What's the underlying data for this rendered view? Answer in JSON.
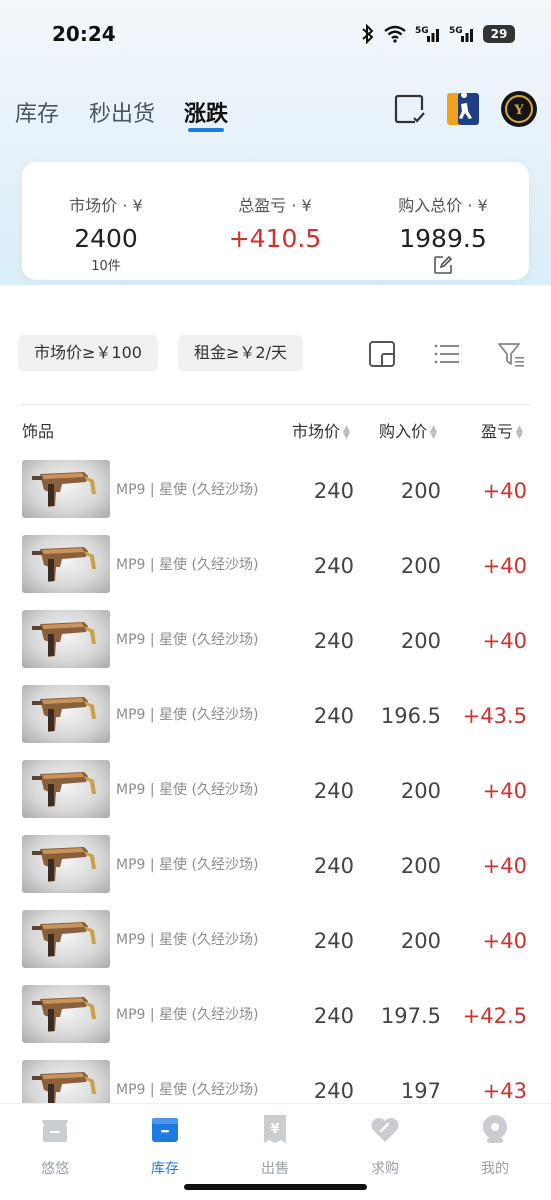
{
  "status": {
    "time": "20:24",
    "battery": "29",
    "net1": "5G",
    "net2": "5G"
  },
  "nav": {
    "tabs": [
      "库存",
      "秒出货",
      "涨跌"
    ],
    "active": 2
  },
  "summary": {
    "market": {
      "label": "市场价 · ¥",
      "value": "2400",
      "sub": "10件"
    },
    "profit": {
      "label": "总盈亏 · ¥",
      "value": "+410.5"
    },
    "cost": {
      "label": "购入总价 · ¥",
      "value": "1989.5"
    }
  },
  "filters": {
    "price_chip": "市场价≥￥100",
    "rent_chip": "租金≥￥2/天"
  },
  "table": {
    "headers": {
      "item": "饰品",
      "market": "市场价",
      "buy": "购入价",
      "pnl": "盈亏"
    },
    "rows": [
      {
        "name": "MP9 | 星使 (久经沙场)",
        "market": "240",
        "buy": "200",
        "pnl": "+40"
      },
      {
        "name": "MP9 | 星使 (久经沙场)",
        "market": "240",
        "buy": "200",
        "pnl": "+40"
      },
      {
        "name": "MP9 | 星使 (久经沙场)",
        "market": "240",
        "buy": "200",
        "pnl": "+40"
      },
      {
        "name": "MP9 | 星使 (久经沙场)",
        "market": "240",
        "buy": "196.5",
        "pnl": "+43.5"
      },
      {
        "name": "MP9 | 星使 (久经沙场)",
        "market": "240",
        "buy": "200",
        "pnl": "+40"
      },
      {
        "name": "MP9 | 星使 (久经沙场)",
        "market": "240",
        "buy": "200",
        "pnl": "+40"
      },
      {
        "name": "MP9 | 星使 (久经沙场)",
        "market": "240",
        "buy": "200",
        "pnl": "+40"
      },
      {
        "name": "MP9 | 星使 (久经沙场)",
        "market": "240",
        "buy": "197.5",
        "pnl": "+42.5"
      },
      {
        "name": "MP9 | 星使 (久经沙场)",
        "market": "240",
        "buy": "197",
        "pnl": "+43"
      }
    ]
  },
  "bottom_nav": [
    {
      "label": "悠悠",
      "icon": "store-icon"
    },
    {
      "label": "库存",
      "icon": "inventory-box-icon"
    },
    {
      "label": "出售",
      "icon": "sell-tag-icon"
    },
    {
      "label": "求购",
      "icon": "heart-icon"
    },
    {
      "label": "我的",
      "icon": "profile-icon"
    }
  ],
  "colors": {
    "accent": "#1f7be0",
    "profit_red": "#d0312d"
  }
}
